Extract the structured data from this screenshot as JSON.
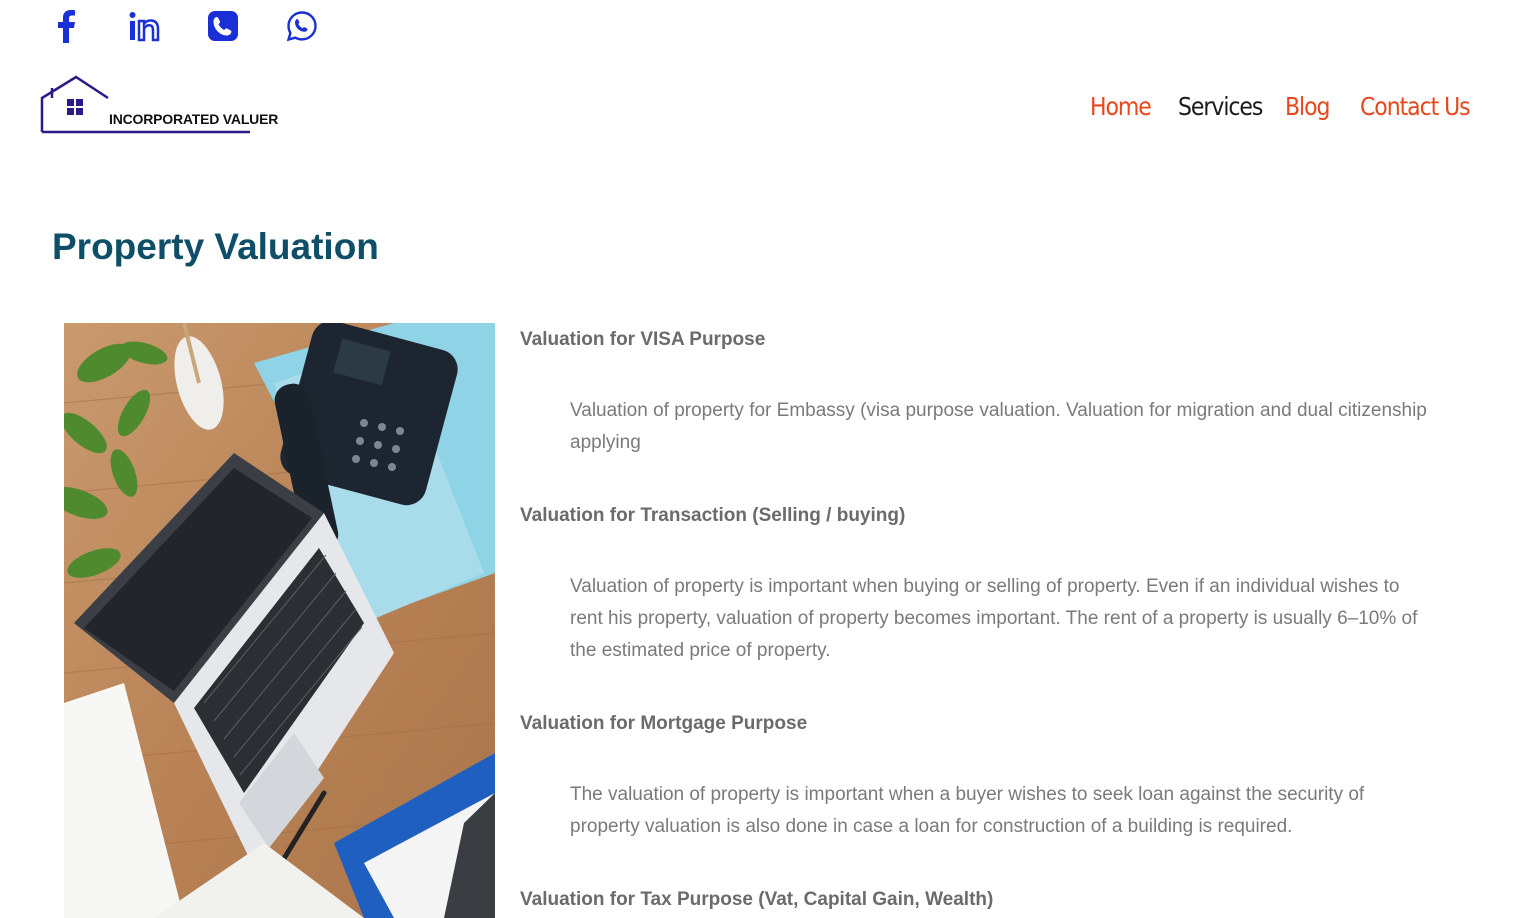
{
  "social": {
    "icons": [
      {
        "name": "facebook-icon",
        "color": "#1a2fd6"
      },
      {
        "name": "linkedin-icon",
        "color": "#1a2fd6"
      },
      {
        "name": "phone-icon",
        "color": "#1a2fd6"
      },
      {
        "name": "whatsapp-icon",
        "color": "#1a2fd6"
      }
    ]
  },
  "logo": {
    "text": "INCORPORATED VALUER",
    "icon": "house-icon",
    "color": "#2a1a8a"
  },
  "nav": {
    "home": "Home",
    "services": "Services",
    "blog": "Blog",
    "contact": "Contact Us",
    "accent_color": "#e8471c",
    "active_color": "#1a1a1a"
  },
  "page": {
    "title": "Property Valuation",
    "title_color": "#0f4e68"
  },
  "photo": {
    "description_icon": "office-desk-image"
  },
  "sections": [
    {
      "heading": "Valuation for VISA Purpose",
      "body": "Valuation of property for Embassy  (visa purpose valuation.  Valuation for migration and dual citizenship applying"
    },
    {
      "heading": "Valuation for Transaction (Selling / buying)",
      "body": "Valuation of property is important when buying or selling of property. Even if an individual wishes to rent his property, valuation of property becomes important. The rent of a property is usually 6–10% of the estimated price of property."
    },
    {
      "heading": "Valuation for Mortgage Purpose",
      "body": "The valuation of property is important when a buyer wishes to seek loan against the security of property valuation is also done in case a loan for construction of a building is required."
    },
    {
      "heading": "Valuation for Tax Purpose (Vat, Capital Gain, Wealth)",
      "body": ""
    }
  ]
}
